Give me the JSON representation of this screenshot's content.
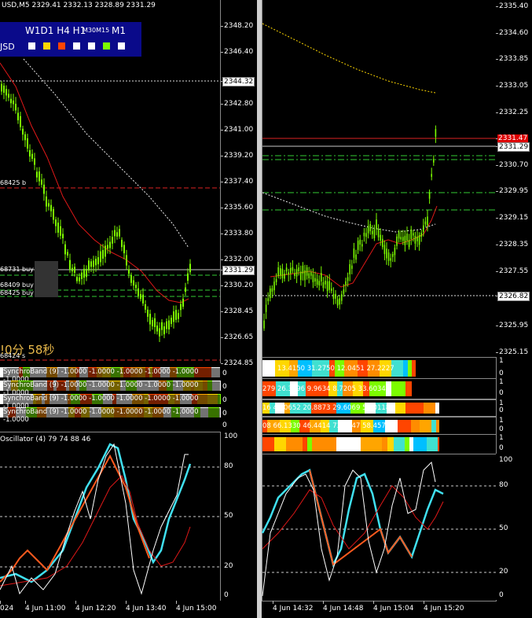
{
  "left": {
    "header": "USD,M5  2329.41 2332.13 2328.89 2331.29",
    "tf_panel": {
      "title": "W1D1 H4 H1",
      "small": "M30M15",
      "last": "M1",
      "symbol": "JSD",
      "squares": [
        "#ffffff",
        "#ffd700",
        "#ff4500",
        "#ffffff",
        "#ffffff",
        "#7cfc00",
        "#ffffff"
      ]
    },
    "price_labels": [
      "2348.20",
      "2346.40",
      "2344.32",
      "2342.80",
      "2341.00",
      "2339.20",
      "2337.40",
      "2335.60",
      "2333.80",
      "2332.00",
      "2331.29",
      "2330.20",
      "2328.45",
      "2326.65",
      "2324.85"
    ],
    "level_labels": [
      "68425 b",
      "68731 buy",
      "68409 buy",
      "68425 buy",
      "68424 s"
    ],
    "countdown": "!0分 58秒",
    "synchro_rows": [
      "SynchroBand (9) -1.0000 -1.0000 -1.0000 -1.0000 -1.0000 -1.0000",
      "SynchroBand (9) -1.0000 -1.0000 -1.0000 -1.0000 -1.0000 -1.0000",
      "SynchroBand (9) -1.0000 -1.0000 -1.0000 -1.0000 -1.0000 -1.0000",
      "SynchroBand (9) -1.0000 -1.0000 -1.0000 -1.0000 -1.0000 -1.0000"
    ],
    "synchro_axis": [
      "0",
      "0",
      "0",
      "0",
      "0"
    ],
    "osc_title": "Oscillator (4) 79 74 88 46",
    "osc_labels": [
      "100",
      "80",
      "50",
      "20",
      "0"
    ],
    "time_labels": [
      "024",
      "4 Jun 11:00",
      "4 Jun 12:20",
      "4 Jun 13:40",
      "4 Jun 15:00"
    ]
  },
  "right": {
    "price_labels": [
      "2335.40",
      "2334.60",
      "2333.85",
      "2333.05",
      "2332.25",
      "2331.47",
      "2331.29",
      "2330.70",
      "2329.95",
      "2329.15",
      "2328.35",
      "2327.55",
      "2326.82",
      "2325.95",
      "2325.15"
    ],
    "ind_rows": [
      {
        "text": "521 13.4150 31.2750 12.0451 27.2227",
        "axis": [
          "1",
          "0"
        ]
      },
      {
        "text": "279 26.3296 9.9634 8.7205 33.6034",
        "axis": [
          "1",
          "0"
        ]
      },
      {
        "text": "16 40.0652 20.8873 29.6069 51.0118",
        "axis": [
          "1",
          "0"
        ]
      },
      {
        "text": "08 66.1330 46.4414 73.9847 58.4571",
        "axis": [
          "1",
          "0"
        ]
      },
      {
        "text": "",
        "axis": [
          "1",
          "0"
        ]
      }
    ],
    "osc_labels": [
      "100",
      "80",
      "50",
      "20",
      "0"
    ],
    "time_labels": [
      "4 Jun 14:32",
      "4 Jun 14:48",
      "4 Jun 15:04",
      "4 Jun 15:20"
    ]
  },
  "colors": {
    "candle": "#7cfc00",
    "ma_red": "#e01818",
    "bid_line": "#c8c8c8",
    "level_red": "#d22",
    "level_green": "#3c3",
    "osc_cyan": "#40e0f0",
    "osc_orange": "#ff5a1e"
  }
}
